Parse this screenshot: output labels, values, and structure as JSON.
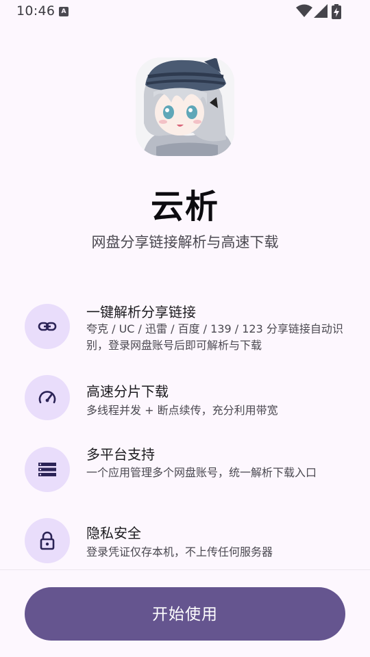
{
  "status_bar": {
    "time": "10:46",
    "notification_icon": "a-letter-icon",
    "wifi_icon": "wifi-icon",
    "signal_icon": "signal-icon",
    "battery_icon": "battery-charging-icon"
  },
  "app": {
    "avatar_icon": "anime-avatar-icon",
    "title": "云析",
    "subtitle": "网盘分享链接解析与高速下载"
  },
  "features": [
    {
      "icon": "link-icon",
      "title": "一键解析分享链接",
      "description": "夸克 / UC / 迅雷 / 百度 / 139 / 123 分享链接自动识别，登录网盘账号后即可解析与下载"
    },
    {
      "icon": "speedometer-icon",
      "title": "高速分片下载",
      "description": "多线程并发 + 断点续传，充分利用带宽"
    },
    {
      "icon": "storage-list-icon",
      "title": "多平台支持",
      "description": "一个应用管理多个网盘账号，统一解析下载入口"
    },
    {
      "icon": "lock-icon",
      "title": "隐私安全",
      "description": "登录凭证仅存本机，不上传任何服务器"
    }
  ],
  "primary_action": {
    "label": "开始使用"
  },
  "colors": {
    "background": "#fdf7fe",
    "icon_circle": "#e9ddfb",
    "icon_glyph": "#2b2356",
    "button": "#65558f",
    "button_text": "#ffffff"
  }
}
